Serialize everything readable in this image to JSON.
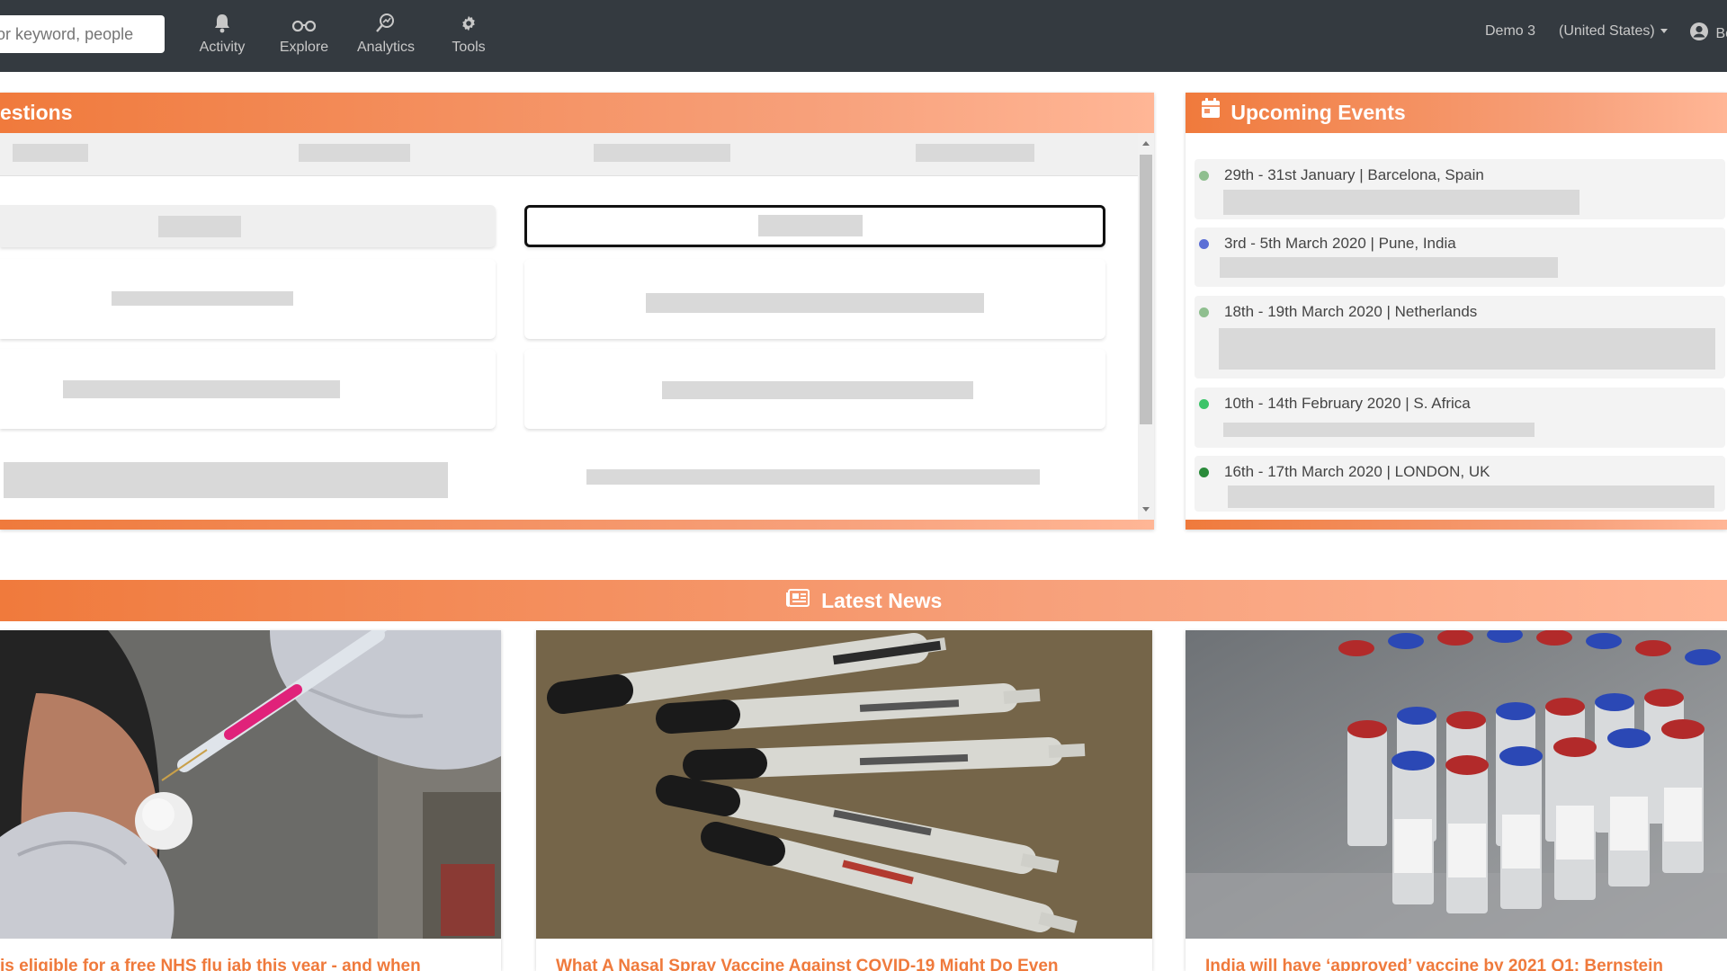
{
  "header": {
    "search_placeholder": "Search for keyword, people",
    "nav": [
      {
        "label": "Activity",
        "icon": "bell-icon"
      },
      {
        "label": "Explore",
        "icon": "binoculars-icon"
      },
      {
        "label": "Analytics",
        "icon": "magnifier-chart-icon"
      },
      {
        "label": "Tools",
        "icon": "gear-icon"
      }
    ],
    "demo_label": "Demo 3",
    "region_label": "(United States)",
    "user_label": "Bo"
  },
  "questions_panel": {
    "title": "estions"
  },
  "events_panel": {
    "title": "Upcoming Events",
    "items": [
      {
        "label": "29th - 31st January | Barcelona, Spain",
        "dot_color": "#8fbf8f"
      },
      {
        "label": "3rd - 5th March 2020 | Pune, India",
        "dot_color": "#5b6fd6"
      },
      {
        "label": "18th - 19th March 2020 | Netherlands",
        "dot_color": "#8fbf8f"
      },
      {
        "label": "10th - 14th February 2020 | S. Africa",
        "dot_color": "#3cc469"
      },
      {
        "label": "16th - 17th March 2020 | LONDON, UK",
        "dot_color": "#2a8a3a"
      }
    ]
  },
  "news": {
    "title": "Latest News",
    "items": [
      {
        "title": "is eligible for a free NHS flu jab this year - and when"
      },
      {
        "title": "What A Nasal Spray Vaccine Against COVID-19 Might Do Even"
      },
      {
        "title": "India will have ‘approved’ vaccine by 2021 Q1: Bernstein"
      }
    ]
  },
  "colors": {
    "accent": "#ef7a3c",
    "nav_bg": "#343a40"
  }
}
